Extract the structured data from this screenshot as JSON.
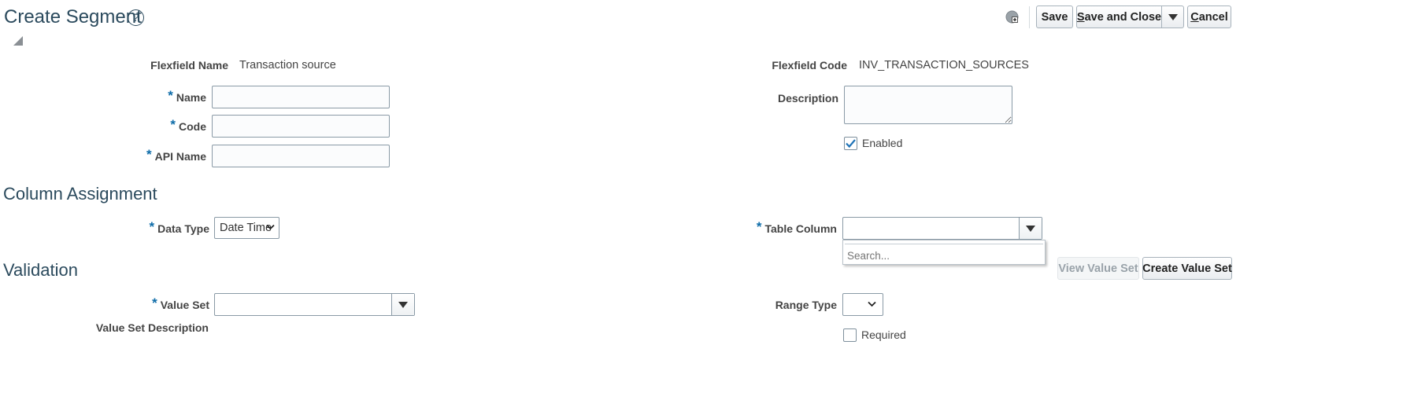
{
  "header": {
    "title": "Create Segment",
    "help_icon": "help-circle-icon",
    "personalize_icon": "personalize-icon"
  },
  "actions": {
    "save": "Save",
    "save_and_close_prefix": "S",
    "save_and_close_rest": "ave and Close",
    "cancel_prefix": "C",
    "cancel_rest": "ancel"
  },
  "segment": {
    "flexfield_name_label": "Flexfield Name",
    "flexfield_name_value": "Transaction source",
    "flexfield_code_label": "Flexfield Code",
    "flexfield_code_value": "INV_TRANSACTION_SOURCES",
    "name_label": "Name",
    "name_value": "",
    "code_label": "Code",
    "code_value": "",
    "api_name_label": "API Name",
    "api_name_value": "",
    "description_label": "Description",
    "description_value": "",
    "enabled_label": "Enabled",
    "enabled_checked": true
  },
  "column_assignment": {
    "section_title": "Column Assignment",
    "data_type_label": "Data Type",
    "data_type_value": "Date Time",
    "table_column_label": "Table Column",
    "table_column_value": "",
    "search_placeholder": "Search..."
  },
  "validation": {
    "section_title": "Validation",
    "view_value_set": "View Value Set",
    "create_value_set": "Create Value Set",
    "value_set_label": "Value Set",
    "value_set_value": "",
    "value_set_description_label": "Value Set Description",
    "range_type_label": "Range Type",
    "range_type_value": "",
    "required_label": "Required",
    "required_checked": false
  },
  "colors": {
    "heading": "#2b4a5d",
    "required_star": "#0c6ba8",
    "link": "#3a6ea5"
  }
}
